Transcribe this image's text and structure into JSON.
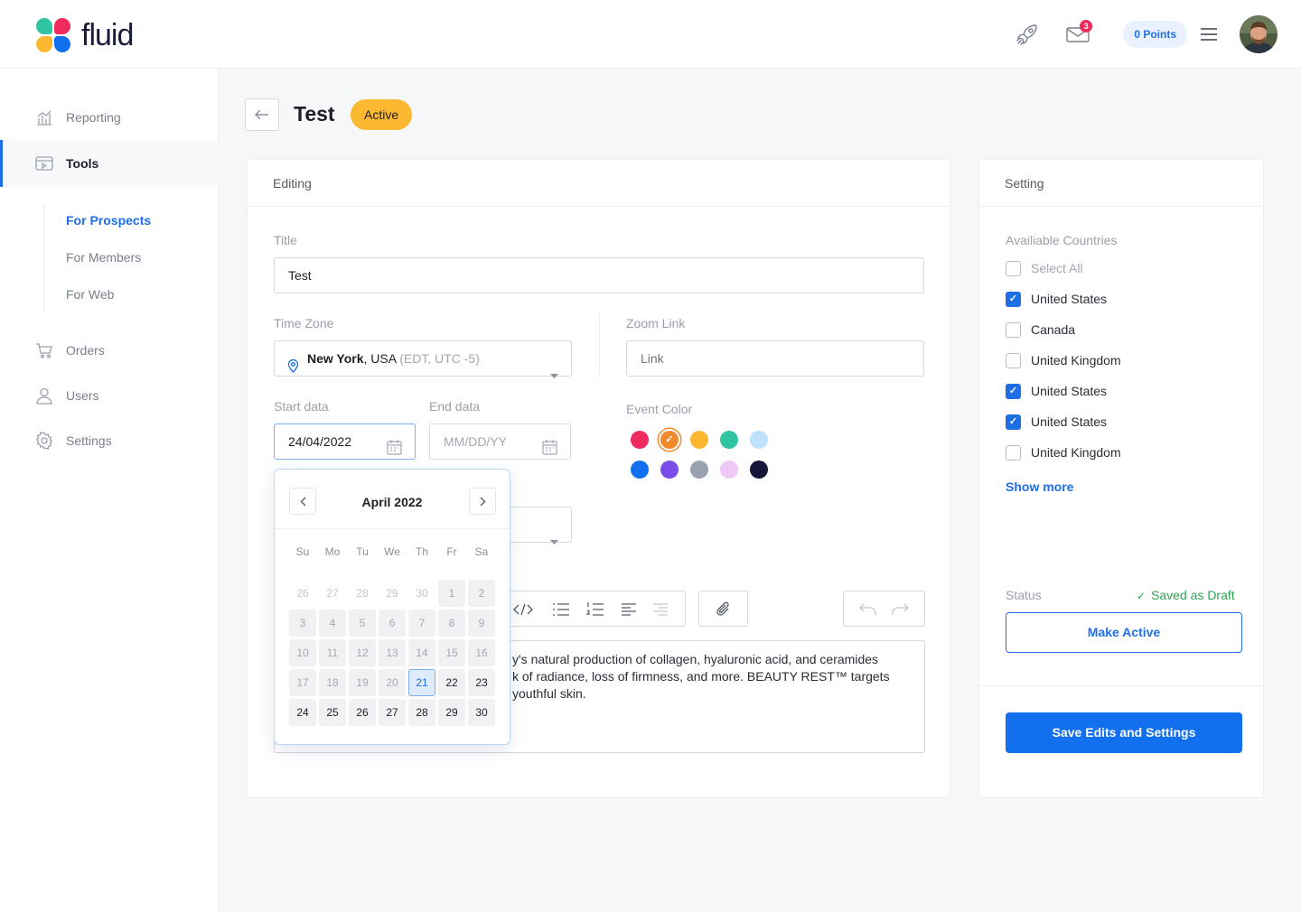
{
  "brand": {
    "name": "fluid"
  },
  "topbar": {
    "mail_count": "3",
    "points_label": "0 Points"
  },
  "sidebar": {
    "items": [
      {
        "label": "Reporting",
        "icon": "chart-icon"
      },
      {
        "label": "Tools",
        "icon": "tools-icon"
      },
      {
        "label": "Orders",
        "icon": "cart-icon"
      },
      {
        "label": "Users",
        "icon": "user-icon"
      },
      {
        "label": "Settings",
        "icon": "gear-icon"
      }
    ],
    "sub_items": [
      "For Prospects",
      "For Members",
      "For Web"
    ]
  },
  "page": {
    "title": "Test",
    "status": "Active"
  },
  "editing": {
    "heading": "Editing",
    "title_label": "Title",
    "title_value": "Test",
    "timezone_label": "Time Zone",
    "timezone_city": "New York",
    "timezone_country": ", USA",
    "timezone_offset": " (EDT, UTC -5)",
    "zoom_label": "Zoom Link",
    "zoom_placeholder": "Link",
    "start_label": "Start data",
    "start_value": "24/04/2022",
    "end_label": "End data",
    "end_placeholder": "MM/DD/YY",
    "color_label": "Event Color",
    "colors": [
      "#ee2a5e",
      "#f08a2c",
      "#fbb830",
      "#31c4a2",
      "#bfe0fb",
      "#1270ef",
      "#7b4de8",
      "#9aa1b0",
      "#eec9f5",
      "#16163a"
    ],
    "selected_color": "#f08a2c",
    "description": "y's natural production of collagen, hyaluronic acid, and ceramides\nk of radiance, loss of firmness, and more. BEAUTY REST™ targets\n youthful skin."
  },
  "calendar": {
    "month_label": "April 2022",
    "weekdays": [
      "Su",
      "Mo",
      "Tu",
      "We",
      "Th",
      "Fr",
      "Sa"
    ],
    "selected_day": "21"
  },
  "setting": {
    "heading": "Setting",
    "countries_label": "Availiable Countries",
    "countries": [
      {
        "label": "Select All",
        "checked": false
      },
      {
        "label": "United States",
        "checked": true
      },
      {
        "label": "Canada",
        "checked": false
      },
      {
        "label": "United Kingdom",
        "checked": false
      },
      {
        "label": "United States",
        "checked": true
      },
      {
        "label": "United States",
        "checked": true
      },
      {
        "label": "United Kingdom",
        "checked": false
      }
    ],
    "show_more": "Show more",
    "status_label": "Status",
    "status_value": "Saved as Draft",
    "make_active": "Make Active",
    "save_button": "Save Edits and Settings"
  }
}
